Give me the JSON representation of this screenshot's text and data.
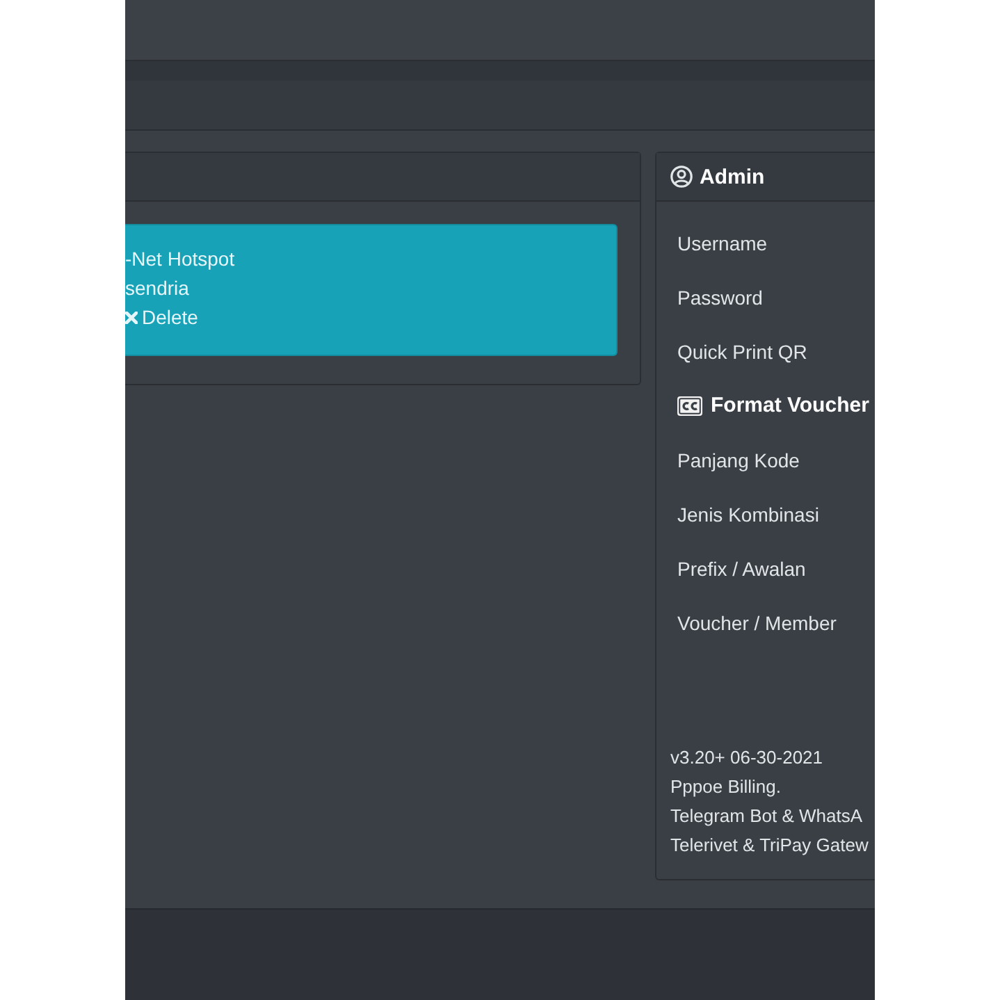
{
  "hotspot_card": {
    "alert": {
      "lines": [
        "-Net Hotspot",
        "sendria"
      ],
      "delete_link": "Delete"
    }
  },
  "admin_card": {
    "title": "Admin",
    "rows": [
      {
        "kind": "field",
        "label": "Username"
      },
      {
        "kind": "field",
        "label": "Password"
      },
      {
        "kind": "field",
        "label": "Quick Print QR"
      },
      {
        "kind": "section",
        "label": "Format Voucher"
      },
      {
        "kind": "field",
        "label": "Panjang Kode"
      },
      {
        "kind": "field",
        "label": "Jenis Kombinasi"
      },
      {
        "kind": "field",
        "label": "Prefix / Awalan"
      },
      {
        "kind": "field",
        "label": "Voucher / Member"
      }
    ],
    "footer_lines": [
      "v3.20+ 06-30-2021",
      "Pppoe Billing.",
      "Telegram Bot & WhatsA",
      "Telerivet & TriPay Gatew"
    ]
  }
}
